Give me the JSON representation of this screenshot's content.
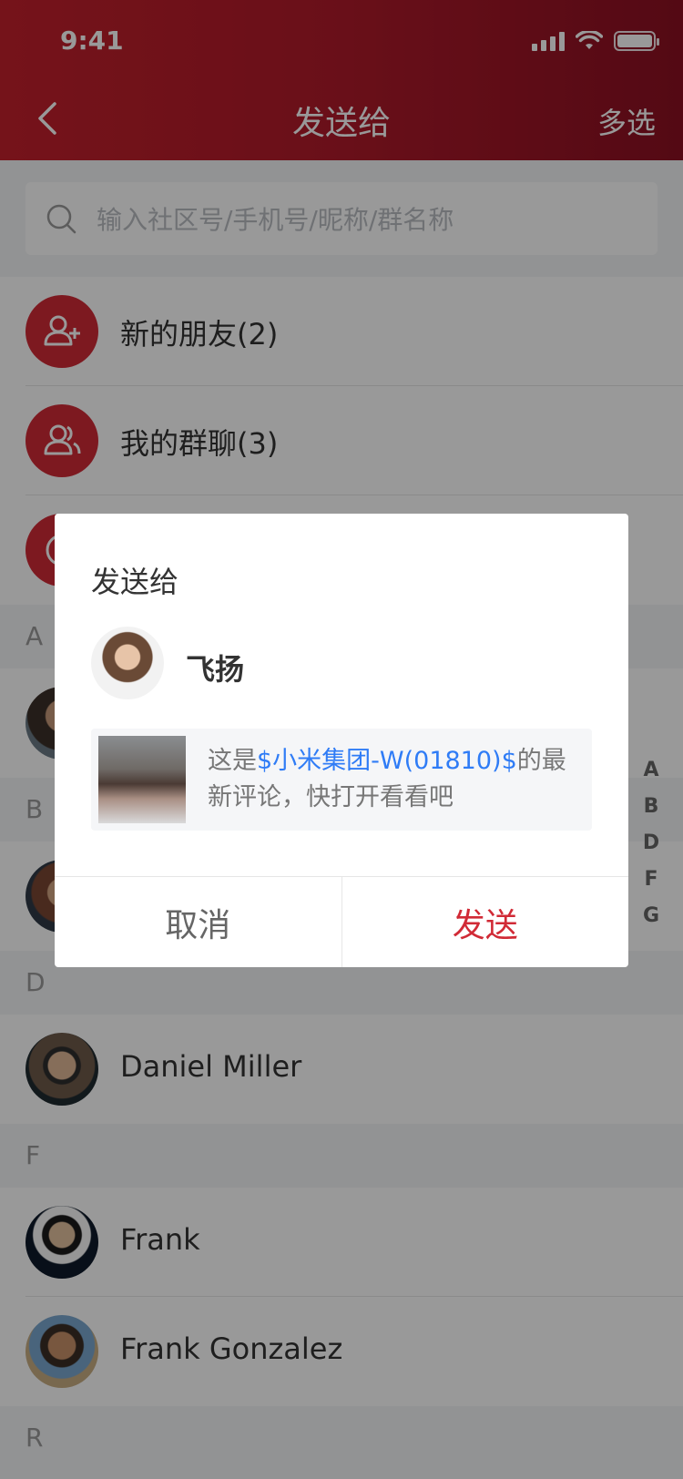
{
  "status_bar": {
    "time": "9:41"
  },
  "nav": {
    "title": "发送给",
    "right_action": "多选"
  },
  "search": {
    "placeholder": "输入社区号/手机号/昵称/群名称"
  },
  "quick_entries": [
    {
      "label": "新的朋友(2)",
      "icon": "user-add-icon"
    },
    {
      "label": "我的群聊(3)",
      "icon": "group-icon"
    },
    {
      "label": "",
      "icon": "at-icon"
    }
  ],
  "sections": {
    "a": "A",
    "b": "B",
    "d": "D",
    "f": "F",
    "r": "R"
  },
  "contacts": {
    "d": [
      {
        "name": "Daniel Miller"
      }
    ],
    "f": [
      {
        "name": "Frank"
      },
      {
        "name": "Frank Gonzalez"
      }
    ]
  },
  "alpha_index": [
    "A",
    "B",
    "D",
    "F",
    "G"
  ],
  "dialog": {
    "title": "发送给",
    "recipient": "飞扬",
    "share_text_prefix": "这是",
    "share_text_highlight": "$小米集团-W(01810)$",
    "share_text_suffix": "的最新评论，快打开看看吧",
    "cancel_label": "取消",
    "send_label": "发送"
  },
  "colors": {
    "brand_red": "#d12a36",
    "link_blue": "#2f7cf6"
  }
}
